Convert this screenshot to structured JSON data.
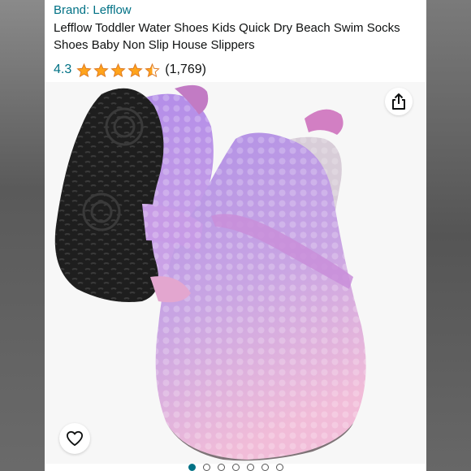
{
  "product": {
    "brand": "Brand: Lefflow",
    "title": "Lefflow Toddler Water Shoes Kids Quick Dry Beach Swim Socks Shoes Baby Non Slip House Slippers",
    "rating_value": "4.3",
    "rating_stars": 4.5,
    "rating_count": "(1,769)"
  },
  "icons": {
    "share": "share-icon",
    "favorite": "heart-icon",
    "star": "star-icon"
  },
  "image": {
    "subject": "product-photo",
    "carousel_total": 7,
    "carousel_active_index": 0
  },
  "colors": {
    "link": "#007185",
    "star": "#ffa41c",
    "text": "#0f1111"
  }
}
